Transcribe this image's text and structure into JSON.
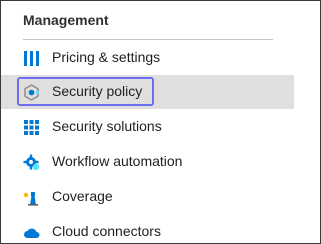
{
  "section": {
    "title": "Management"
  },
  "nav": {
    "items": [
      {
        "label": "Pricing & settings",
        "icon": "pricing-settings-icon"
      },
      {
        "label": "Security policy",
        "icon": "security-policy-icon",
        "selected": true
      },
      {
        "label": "Security solutions",
        "icon": "security-solutions-icon"
      },
      {
        "label": "Workflow automation",
        "icon": "workflow-automation-icon"
      },
      {
        "label": "Coverage",
        "icon": "coverage-icon"
      },
      {
        "label": "Cloud connectors",
        "icon": "cloud-connectors-icon"
      }
    ]
  },
  "colors": {
    "selected_background": "#e1dfdd",
    "focus_ring": "#6b6ef0",
    "icon_blue": "#0078d4"
  }
}
